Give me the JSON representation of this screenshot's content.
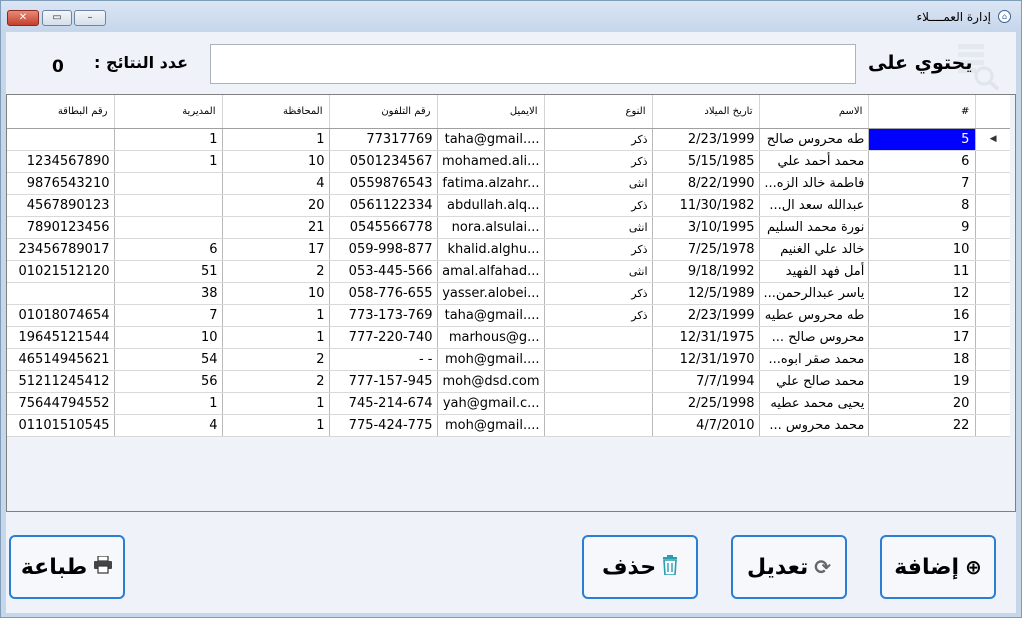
{
  "window": {
    "title": "إدارة العمــــلاء",
    "close": "✕",
    "maximize": "▭",
    "minimize": "–"
  },
  "search": {
    "label": "يحتوي على",
    "value": "",
    "results_label": "عدد النتائج :",
    "results_count": "0"
  },
  "table": {
    "columns": [
      "#",
      "الاسم",
      "تاريخ الميلاد",
      "النوع",
      "الايميل",
      "رقم التلفون",
      "المحافظة",
      "المديرية",
      "رقم البطاقة"
    ],
    "indicator": "◀",
    "rows": [
      [
        "5",
        "طه محروس صالح",
        "2/23/1999",
        "ذكر",
        "taha@gmail....",
        "77317769",
        "1",
        "1",
        ""
      ],
      [
        "6",
        "محمد أحمد علي",
        "5/15/1985",
        "ذكر",
        "mohamed.ali...",
        "0501234567",
        "10",
        "1",
        "1234567890"
      ],
      [
        "7",
        "فاطمة خالد الزه...",
        "8/22/1990",
        "انثى",
        "fatima.alzahr...",
        "0559876543",
        "4",
        "",
        "9876543210"
      ],
      [
        "8",
        "عبدالله سعد ال...",
        "11/30/1982",
        "ذكر",
        "abdullah.alq...",
        "0561122334",
        "20",
        "",
        "4567890123"
      ],
      [
        "9",
        "نورة محمد السليم",
        "3/10/1995",
        "انثى",
        "nora.alsulai...",
        "0545566778",
        "21",
        "",
        "7890123456"
      ],
      [
        "10",
        "خالد علي الغنيم",
        "7/25/1978",
        "ذكر",
        "khalid.alghu...",
        "059-998-877",
        "17",
        "6",
        "23456789017"
      ],
      [
        "11",
        "أمل فهد الفهيد",
        "9/18/1992",
        "انثى",
        "amal.alfahad...",
        "053-445-566",
        "2",
        "51",
        "01021512120"
      ],
      [
        "12",
        "ياسر عبدالرحمن...",
        "12/5/1989",
        "ذكر",
        "yasser.alobei...",
        "058-776-655",
        "10",
        "38",
        ""
      ],
      [
        "16",
        "طه محروس عطيه",
        "2/23/1999",
        "ذكر",
        "taha@gmail....",
        "773-173-769",
        "1",
        "7",
        "01018074654"
      ],
      [
        "17",
        "محروس صالح ...",
        "12/31/1975",
        "",
        "marhous@g...",
        "777-220-740",
        "1",
        "10",
        "19645121544"
      ],
      [
        "18",
        "محمد صقر ابوه...",
        "12/31/1970",
        "",
        "moh@gmail....",
        "-   -",
        "2",
        "54",
        "46514945621"
      ],
      [
        "19",
        "محمد صالح علي",
        "7/7/1994",
        "",
        "moh@dsd.com",
        "777-157-945",
        "2",
        "56",
        "51211245412"
      ],
      [
        "20",
        "يحيى محمد عطيه",
        "2/25/1998",
        "",
        "yah@gmail.c...",
        "745-214-674",
        "1",
        "1",
        "75644794552"
      ],
      [
        "22",
        "محمد محروس ...",
        "4/7/2010",
        "",
        "moh@gmail....",
        "775-424-775",
        "1",
        "4",
        "01101510545"
      ]
    ]
  },
  "buttons": {
    "add": "إضافة",
    "edit": "تعديل",
    "delete": "حذف",
    "print": "طباعة"
  },
  "colors": {
    "accent": "#2b7fd3",
    "selection": "#0000ff"
  }
}
